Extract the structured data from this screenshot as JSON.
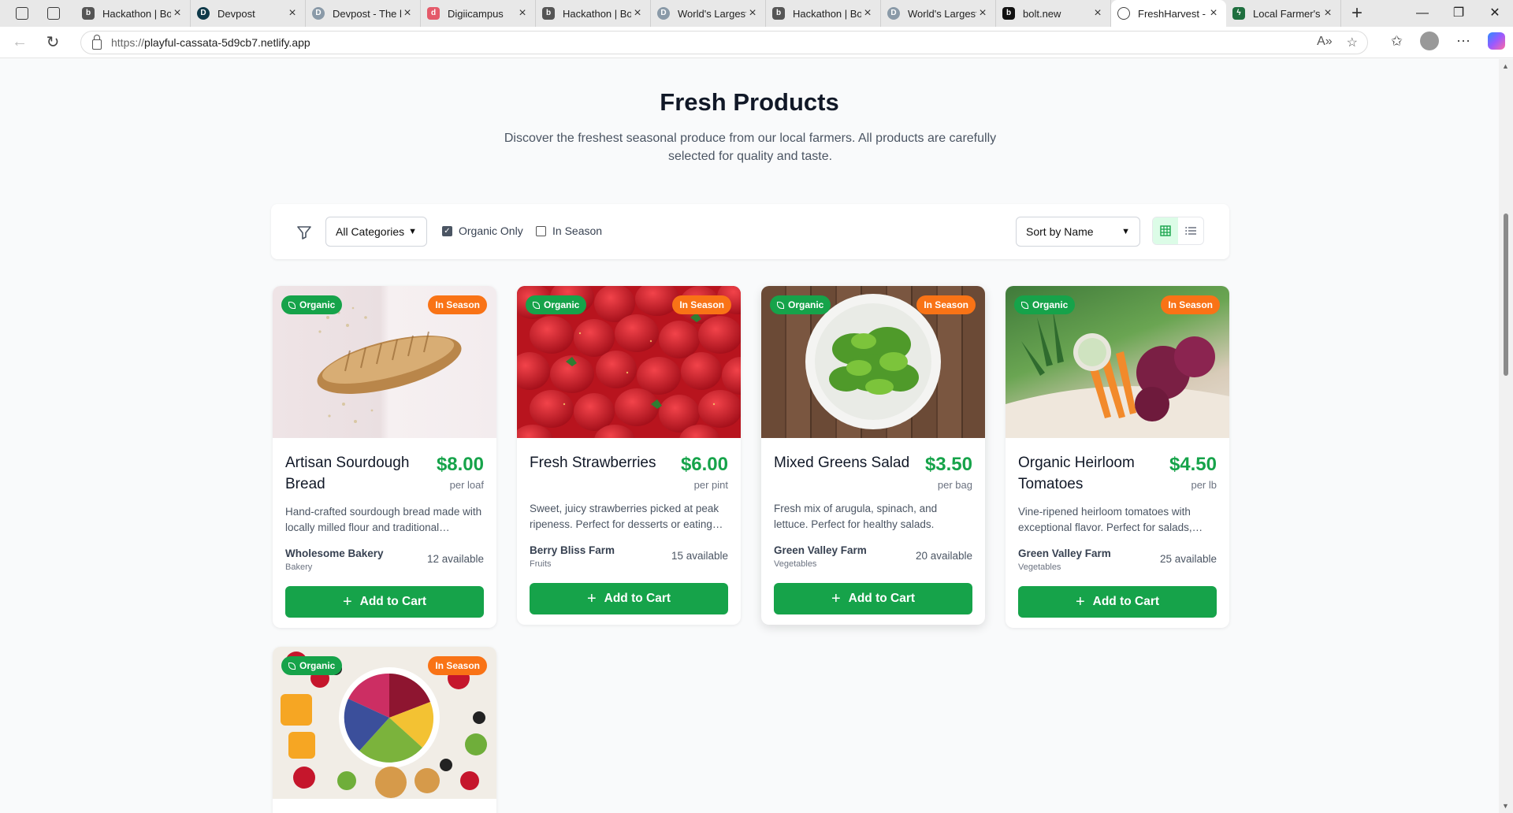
{
  "browser": {
    "tabs": [
      {
        "title": "Hackathon | Bolt",
        "favicon": "b"
      },
      {
        "title": "Devpost",
        "favicon": "D"
      },
      {
        "title": "Devpost - The h",
        "favicon": "D"
      },
      {
        "title": "Digiicampus",
        "favicon": "d"
      },
      {
        "title": "Hackathon | Bolt",
        "favicon": "b"
      },
      {
        "title": "World's Largest",
        "favicon": "D"
      },
      {
        "title": "Hackathon | Bolt",
        "favicon": "b"
      },
      {
        "title": "World's Largest",
        "favicon": "D"
      },
      {
        "title": "bolt.new",
        "favicon": "b"
      },
      {
        "title": "FreshHarvest - L",
        "favicon": "globe"
      },
      {
        "title": "Local Farmer's M",
        "favicon": "bolt"
      }
    ],
    "active_tab": 9,
    "url": "https://playful-cassata-5d9cb7.netlify.app",
    "url_host": "playful-cassata-5d9cb7.netlify.app",
    "url_scheme": "https://"
  },
  "page": {
    "title": "Fresh Products",
    "subtitle": "Discover the freshest seasonal produce from our local farmers. All products are carefully selected for quality and taste."
  },
  "filters": {
    "category_selected": "All Categories",
    "organic_label": "Organic Only",
    "organic_checked": true,
    "season_label": "In Season",
    "season_checked": false,
    "sort_selected": "Sort by Name",
    "view_mode": "grid"
  },
  "labels": {
    "organic_badge": "Organic",
    "season_badge": "In Season",
    "add_to_cart": "Add to Cart"
  },
  "colors": {
    "accent": "#16a34a",
    "season": "#f97316"
  },
  "products": [
    {
      "name": "Artisan Sourdough Bread",
      "price": "$8.00",
      "unit": "per loaf",
      "description": "Hand-crafted sourdough bread made with locally milled flour and traditional…",
      "farm": "Wholesome Bakery",
      "category": "Bakery",
      "available": "12 available"
    },
    {
      "name": "Fresh Strawberries",
      "price": "$6.00",
      "unit": "per pint",
      "description": "Sweet, juicy strawberries picked at peak ripeness. Perfect for desserts or eating…",
      "farm": "Berry Bliss Farm",
      "category": "Fruits",
      "available": "15 available"
    },
    {
      "name": "Mixed Greens Salad",
      "price": "$3.50",
      "unit": "per bag",
      "description": "Fresh mix of arugula, spinach, and lettuce. Perfect for healthy salads.",
      "farm": "Green Valley Farm",
      "category": "Vegetables",
      "available": "20 available"
    },
    {
      "name": "Organic Heirloom Tomatoes",
      "price": "$4.50",
      "unit": "per lb",
      "description": "Vine-ripened heirloom tomatoes with exceptional flavor. Perfect for salads,…",
      "farm": "Green Valley Farm",
      "category": "Vegetables",
      "available": "25 available"
    }
  ]
}
